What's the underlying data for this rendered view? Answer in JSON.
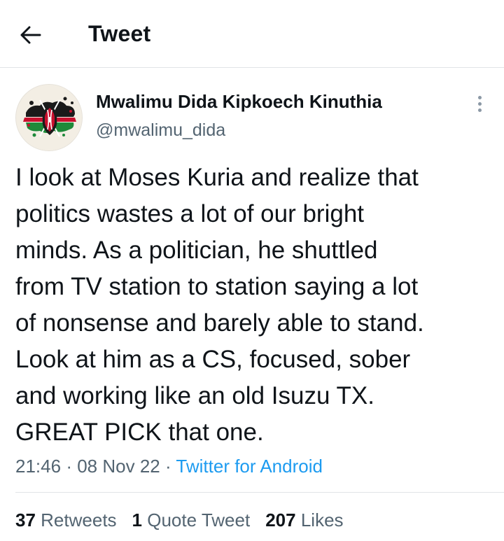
{
  "header": {
    "title": "Tweet",
    "back_icon": "arrow-left-icon"
  },
  "tweet": {
    "author": {
      "name": "Mwalimu Dida Kipkoech Kinuthia",
      "handle": "@mwalimu_dida",
      "avatar_icon": "kenya-flag-shield-avatar"
    },
    "more_icon": "more-vertical-icon",
    "text_lines": [
      "I look at Moses Kuria and realize that",
      "politics wastes a lot of our bright",
      "minds. As a politician, he shuttled",
      "from TV station to station saying a lot",
      "of nonsense and barely able to stand.",
      "Look at him as a CS, focused, sober",
      "and working like an old Isuzu TX.",
      "GREAT PICK that one."
    ],
    "time": "21:46",
    "date": "08 Nov 22",
    "separator": "·",
    "source": "Twitter for Android"
  },
  "stats": {
    "retweets_count": "37",
    "retweets_label": "Retweets",
    "quotes_count": "1",
    "quotes_label": "Quote Tweet",
    "likes_count": "207",
    "likes_label": "Likes"
  },
  "colors": {
    "link": "#1d9bf0",
    "secondary_text": "#536471",
    "primary_text": "#0f1419",
    "divider": "#e1e4e7"
  }
}
